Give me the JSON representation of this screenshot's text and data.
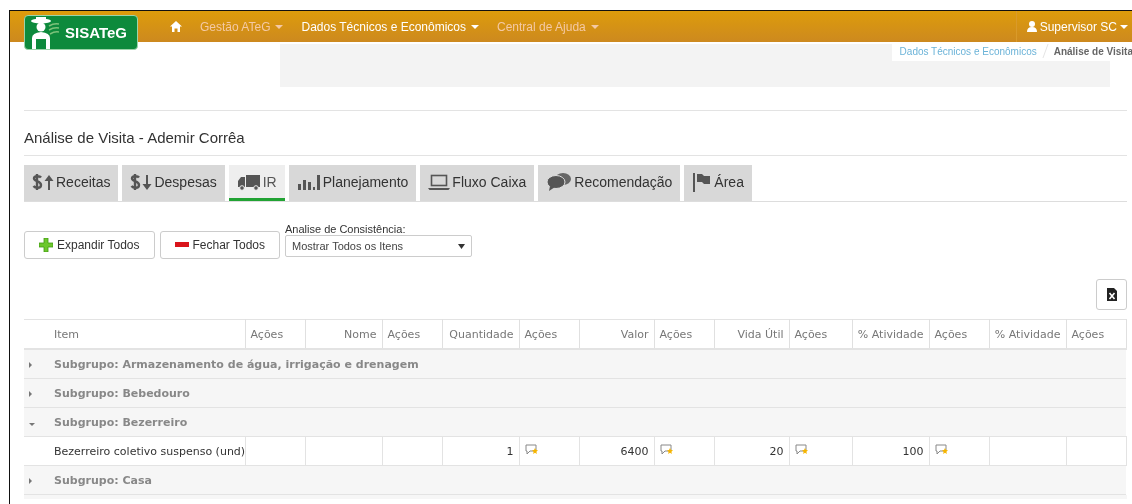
{
  "navbar": {
    "brand": "SISATeG",
    "menu": [
      {
        "label": "Gestão ATeG",
        "selected": false
      },
      {
        "label": "Dados Técnicos e Econômicos",
        "selected": true
      },
      {
        "label": "Central de Ajuda",
        "selected": false
      }
    ],
    "user": "Supervisor SC"
  },
  "breadcrumb": [
    {
      "label": "Dados Técnicos e Econômicos",
      "kind": "link"
    },
    {
      "label": "Análise de Visita",
      "kind": "current"
    }
  ],
  "page_title": "Análise de Visita - Ademir Corrêa",
  "tabs": [
    {
      "label": "Receitas",
      "selected": false
    },
    {
      "label": "Despesas",
      "selected": false
    },
    {
      "label": "IR",
      "selected": true
    },
    {
      "label": "Planejamento",
      "selected": false
    },
    {
      "label": "Fluxo Caixa",
      "selected": false
    },
    {
      "label": "Recomendação",
      "selected": false
    },
    {
      "label": "Área",
      "selected": false
    }
  ],
  "toolbar": {
    "buttons": [
      {
        "label": "Expandir Todos"
      },
      {
        "label": "Fechar Todos"
      }
    ],
    "filter_label": "Analise de Consistência:",
    "filter_value": "Mostrar Todos os Itens"
  },
  "table": {
    "columns": [
      "Item",
      "Ações",
      "Nome",
      "Ações",
      "Quantidade",
      "Ações",
      "Valor",
      "Ações",
      "Vida Útil",
      "Ações",
      "% Atividade",
      "Ações",
      "% Atividade",
      "Ações"
    ],
    "rows": [
      {
        "kind": "group",
        "label": "Subgrupo: Armazenamento de água, irrigação e drenagem",
        "expanded": false
      },
      {
        "kind": "group",
        "label": "Subgrupo: Bebedouro",
        "expanded": false
      },
      {
        "kind": "group",
        "label": "Subgrupo: Bezerreiro",
        "expanded": true
      },
      {
        "kind": "item",
        "item": "Bezerreiro coletivo suspenso (und)",
        "quantidade": "1",
        "valor": "6400",
        "vida_util": "20",
        "atividade": "100"
      },
      {
        "kind": "group",
        "label": "Subgrupo: Casa",
        "expanded": false
      }
    ]
  }
}
